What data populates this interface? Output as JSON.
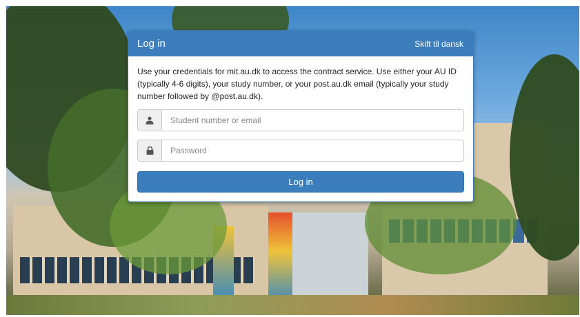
{
  "header": {
    "title": "Log in",
    "language_link": "Skift til dansk"
  },
  "intro_text": "Use your credentials for mit.au.dk to access the contract service. Use either your AU ID (typically 4-6 digits), your study number, or your post.au.dk email (typically your study number followed by @post.au.dk).",
  "fields": {
    "username": {
      "icon": "user-icon",
      "placeholder": "Student number or email",
      "value": ""
    },
    "password": {
      "icon": "lock-icon",
      "placeholder": "Password",
      "value": ""
    }
  },
  "submit_label": "Log in",
  "colors": {
    "primary": "#3b7dbd",
    "addon_background": "#efefef"
  }
}
